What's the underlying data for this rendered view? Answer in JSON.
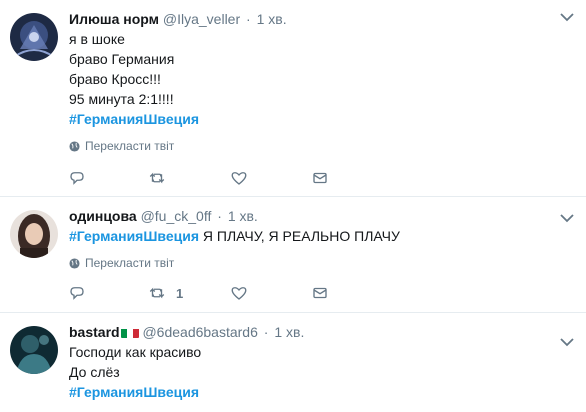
{
  "tweets": [
    {
      "name": "Илюша норм",
      "handle": "@Ilya_veller",
      "dot": "·",
      "time": "1 хв.",
      "lines": [
        "я в шоке",
        "браво Германия",
        "браво Кросс!!!",
        "95 минута 2:1!!!!"
      ],
      "hashtag": "#ГерманияШвеция",
      "translate": "Перекласти твіт",
      "retweet_count": "",
      "avatar_colors": [
        "#1e2a44",
        "#6a7fb8"
      ]
    },
    {
      "name": "одинцова",
      "handle": "@fu_ck_0ff",
      "dot": "·",
      "time": "1 хв.",
      "hashtag": "#ГерманияШвеция",
      "text_after_hashtag": " Я ПЛАЧУ, Я РЕАЛЬНО ПЛАЧУ",
      "translate": "Перекласти твіт",
      "retweet_count": "1",
      "avatar_colors": [
        "#d9cfc9",
        "#3b2a25"
      ]
    },
    {
      "name": "bastard",
      "handle": "@6dead6bastard6",
      "dot": "·",
      "time": "1 хв.",
      "lines": [
        "Господи как красиво",
        "До слёз"
      ],
      "hashtag": "#ГерманияШвеция",
      "avatar_colors": [
        "#2f5f6a",
        "#0f2a33"
      ],
      "flag_colors": [
        "#009246",
        "#ffffff",
        "#ce2b37"
      ]
    }
  ],
  "colors": {
    "link": "#1b95e0",
    "muted": "#657786",
    "text": "#14171a",
    "divider": "#e6ecf0"
  },
  "icons": {
    "reply": "reply-icon",
    "retweet": "retweet-icon",
    "like": "heart-icon",
    "dm": "envelope-icon",
    "caret": "chevron-down-icon",
    "globe": "globe-icon"
  }
}
